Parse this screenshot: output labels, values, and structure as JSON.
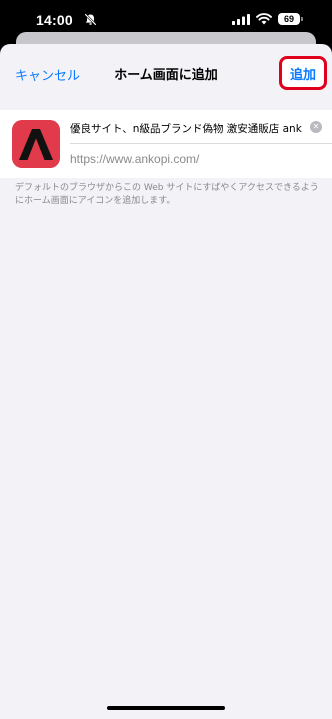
{
  "status_bar": {
    "time": "14:00",
    "battery": "69",
    "icons": [
      "bell-off-icon",
      "signal-icon",
      "wifi-icon",
      "battery-icon"
    ]
  },
  "nav": {
    "cancel_label": "キャンセル",
    "title": "ホーム画面に追加",
    "add_label": "追加",
    "add_highlight_color": "#e0001b"
  },
  "bookmark": {
    "name_value": "優良サイト、n級品ブランド偽物 激安通販店 ankopi",
    "url": "https://www.ankopi.com/",
    "icon_colors": {
      "background": "#e13a4a",
      "letter": "#111111"
    }
  },
  "description": "デフォルトのブラウザからこの Web サイトにすばやくアクセスできるようにホーム画面にアイコンを追加します。",
  "colors": {
    "accent": "#0a7aff",
    "sheet_background": "#f2f2f7"
  }
}
